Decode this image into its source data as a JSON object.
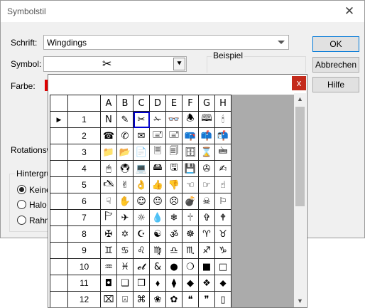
{
  "dialog": {
    "title": "Symbolstil",
    "close_glyph": "✕",
    "font_label": "Schrift:",
    "font_value": "Wingdings",
    "symbol_label": "Symbol:",
    "symbol_value": "✂",
    "symbol_dropdown_glyph": "⯆",
    "color_label": "Farbe:",
    "color_value": "#e00000",
    "example_label": "Beispiel",
    "rotation_label": "Rotationswi",
    "background_group_label": "Hintergrun",
    "radio_none": "Keine",
    "radio_halo": "Halo",
    "radio_frame": "Rahme",
    "ok": "OK",
    "cancel": "Abbrechen",
    "help": "Hilfe"
  },
  "popup": {
    "close_glyph": "x",
    "columns": [
      "A",
      "B",
      "C",
      "D",
      "E",
      "F",
      "G",
      "H"
    ],
    "selected_row_marker": "▶",
    "rows": [
      {
        "num": "1",
        "cells": [
          "N",
          "✎",
          "✂",
          "✁",
          "👓",
          "🕭",
          "🕮",
          "🕯"
        ]
      },
      {
        "num": "2",
        "cells": [
          "☎",
          "✆",
          "✉",
          "🖃",
          "🖃",
          "📪",
          "📫",
          "📬"
        ]
      },
      {
        "num": "3",
        "cells": [
          "📁",
          "📂",
          "📄",
          "🗏",
          "🗐",
          "🗄",
          "⌛",
          "🖮"
        ]
      },
      {
        "num": "4",
        "cells": [
          "🖰",
          "🖲",
          "💻",
          "🖴",
          "🖫",
          "💾",
          "✇",
          "✍"
        ]
      },
      {
        "num": "5",
        "cells": [
          "🖎",
          "✌",
          "👌",
          "👍",
          "👎",
          "☜",
          "☞",
          "☝"
        ]
      },
      {
        "num": "6",
        "cells": [
          "☟",
          "✋",
          "☺",
          "😐",
          "☹",
          "💣",
          "☠",
          "⚐"
        ]
      },
      {
        "num": "7",
        "cells": [
          "🏱",
          "✈",
          "☼",
          "💧",
          "❄",
          "🕆",
          "✞",
          "🕈"
        ]
      },
      {
        "num": "8",
        "cells": [
          "✠",
          "✡",
          "☪",
          "☯",
          "ॐ",
          "☸",
          "♈",
          "♉"
        ]
      },
      {
        "num": "9",
        "cells": [
          "♊",
          "♋",
          "♌",
          "♍",
          "♎",
          "♏",
          "♐",
          "♑"
        ]
      },
      {
        "num": "10",
        "cells": [
          "♒",
          "♓",
          "𝓮𝓽",
          "&",
          "●",
          "❍",
          "■",
          "□"
        ]
      },
      {
        "num": "11",
        "cells": [
          "◘",
          "❑",
          "❒",
          "⬧",
          "⧫",
          "◆",
          "❖",
          "⬥"
        ]
      },
      {
        "num": "12",
        "cells": [
          "⌧",
          "⍓",
          "⌘",
          "❀",
          "✿",
          "❝",
          "❞",
          "▯"
        ]
      }
    ]
  }
}
